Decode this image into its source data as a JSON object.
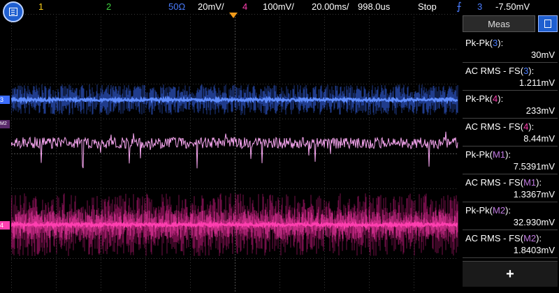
{
  "topbar": {
    "ch1": "1",
    "ch2": "2",
    "ch3_impedance": "50Ω",
    "ch3_scale": "20mV/",
    "ch4": "4",
    "ch4_scale": "100mV/",
    "timebase": "20.00ms/",
    "delay": "998.0us",
    "run_state": "Stop",
    "trigger_icon": "trigger-edge-icon",
    "trigger_channel": "3",
    "trigger_level": "-7.50mV"
  },
  "markers": {
    "ch3": "3",
    "m2": "M2",
    "ch4": "4"
  },
  "panel": {
    "title": "Meas",
    "add_label": "+",
    "measurements": [
      {
        "name": "Pk-Pk(",
        "src": "3",
        "tail": "):",
        "value": "30mV",
        "src_color": "#4a7dff"
      },
      {
        "name": "AC RMS - FS(",
        "src": "3",
        "tail": "):",
        "value": "1.211mV",
        "src_color": "#4a7dff"
      },
      {
        "name": "Pk-Pk(",
        "src": "4",
        "tail": "):",
        "value": "233mV",
        "src_color": "#ff3fb0"
      },
      {
        "name": "AC RMS - FS(",
        "src": "4",
        "tail": "):",
        "value": "8.44mV",
        "src_color": "#ff3fb0"
      },
      {
        "name": "Pk-Pk(",
        "src": "M1",
        "tail": "):",
        "value": "7.5391mV",
        "src_color": "#c07ae0"
      },
      {
        "name": "AC RMS - FS(",
        "src": "M1",
        "tail": "):",
        "value": "1.3367mV",
        "src_color": "#c07ae0"
      },
      {
        "name": "Pk-Pk(",
        "src": "M2",
        "tail": "):",
        "value": "32.930mV",
        "src_color": "#c07ae0"
      },
      {
        "name": "AC RMS - FS(",
        "src": "M2",
        "tail": "):",
        "value": "1.8403mV",
        "src_color": "#c07ae0"
      }
    ]
  },
  "colors": {
    "ch1": "#ffd21a",
    "ch2": "#3fd23f",
    "ch3": "#3b6dff",
    "ch4": "#ff3fb0",
    "math1": "#f7a6f0",
    "math2": "#c0197a",
    "trigger": "#3b6dff",
    "accent": "#1f5fd0"
  }
}
